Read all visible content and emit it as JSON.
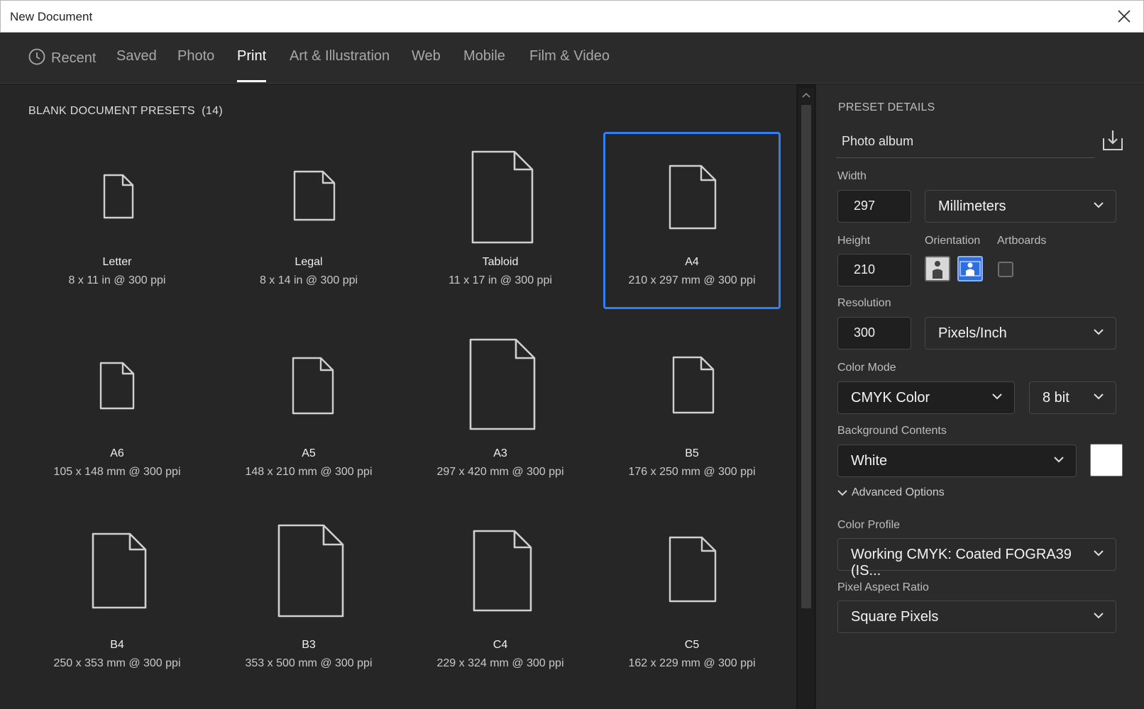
{
  "window": {
    "title": "New Document"
  },
  "tabs": [
    {
      "label": "Recent",
      "icon": "clock-icon"
    },
    {
      "label": "Saved"
    },
    {
      "label": "Photo"
    },
    {
      "label": "Print",
      "active": true
    },
    {
      "label": "Art & Illustration"
    },
    {
      "label": "Web"
    },
    {
      "label": "Mobile"
    },
    {
      "label": "Film & Video"
    }
  ],
  "presets": {
    "heading": "BLANK DOCUMENT PRESETS",
    "count": "(14)",
    "items": [
      {
        "name": "Letter",
        "dims": "8 x 11 in @ 300 ppi"
      },
      {
        "name": "Legal",
        "dims": "8 x 14 in @ 300 ppi"
      },
      {
        "name": "Tabloid",
        "dims": "11 x 17 in @ 300 ppi"
      },
      {
        "name": "A4",
        "dims": "210 x 297 mm @ 300 ppi",
        "selected": true
      },
      {
        "name": "A6",
        "dims": "105 x 148 mm @ 300 ppi"
      },
      {
        "name": "A5",
        "dims": "148 x 210 mm @ 300 ppi"
      },
      {
        "name": "A3",
        "dims": "297 x 420 mm @ 300 ppi"
      },
      {
        "name": "B5",
        "dims": "176 x 250 mm @ 300 ppi"
      },
      {
        "name": "B4",
        "dims": "250 x 353 mm @ 300 ppi"
      },
      {
        "name": "B3",
        "dims": "353 x 500 mm @ 300 ppi"
      },
      {
        "name": "C4",
        "dims": "229 x 324 mm @ 300 ppi"
      },
      {
        "name": "C5",
        "dims": "162 x 229 mm @ 300 ppi"
      }
    ]
  },
  "details": {
    "heading": "PRESET DETAILS",
    "preset_name": "Photo album",
    "width_label": "Width",
    "width_value": "297",
    "width_unit": "Millimeters",
    "height_label": "Height",
    "height_value": "210",
    "orientation_label": "Orientation",
    "orientation_selected": "landscape",
    "artboards_label": "Artboards",
    "artboards_checked": false,
    "resolution_label": "Resolution",
    "resolution_value": "300",
    "resolution_unit": "Pixels/Inch",
    "color_mode_label": "Color Mode",
    "color_mode": "CMYK Color",
    "bit_depth": "8 bit",
    "background_label": "Background Contents",
    "background": "White",
    "background_color": "#ffffff",
    "advanced_label": "Advanced Options",
    "color_profile_label": "Color Profile",
    "color_profile": "Working CMYK: Coated FOGRA39 (IS...",
    "pixel_aspect_label": "Pixel Aspect Ratio",
    "pixel_aspect": "Square Pixels"
  },
  "colors": {
    "accent": "#2f7ff7",
    "background": "#262626",
    "panel": "#2b2b2b"
  }
}
